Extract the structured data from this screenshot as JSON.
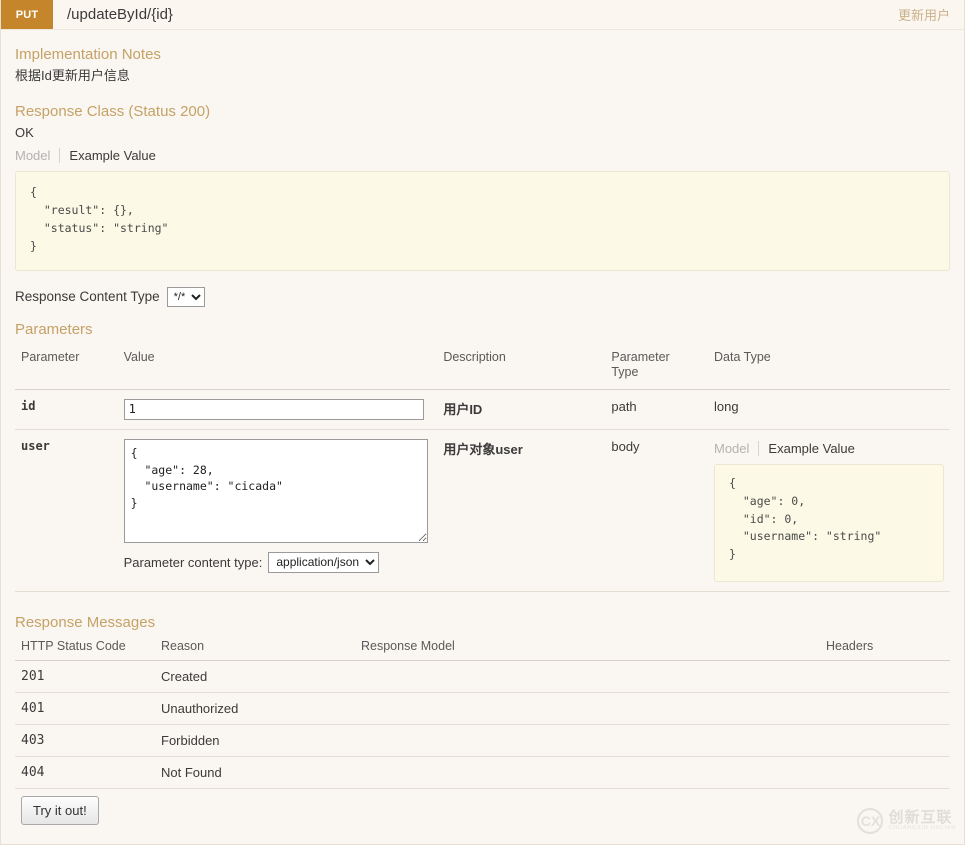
{
  "operation": {
    "method": "PUT",
    "path": "/updateById/{id}",
    "summary": "更新用户"
  },
  "implementation_notes": {
    "heading": "Implementation Notes",
    "text": "根据Id更新用户信息"
  },
  "response_class": {
    "heading": "Response Class (Status 200)",
    "status_text": "OK",
    "tabs": {
      "model": "Model",
      "example": "Example Value"
    },
    "example_value": "{\n  \"result\": {},\n  \"status\": \"string\"\n}"
  },
  "response_content_type": {
    "label": "Response Content Type",
    "selected": "*/*",
    "options": [
      "*/*"
    ]
  },
  "parameters": {
    "heading": "Parameters",
    "columns": {
      "parameter": "Parameter",
      "value": "Value",
      "description": "Description",
      "parameter_type_line1": "Parameter",
      "parameter_type_line2": "Type",
      "data_type": "Data Type"
    },
    "rows": [
      {
        "name": "id",
        "value": "1",
        "description": "用户ID",
        "param_type": "path",
        "data_type": "long"
      },
      {
        "name": "user",
        "value": "{\n  \"age\": 28,\n  \"username\": \"cicada\"\n}",
        "description": "用户对象user",
        "param_type": "body",
        "data_type_tabs": {
          "model": "Model",
          "example": "Example Value"
        },
        "data_type_example": "{\n  \"age\": 0,\n  \"id\": 0,\n  \"username\": \"string\"\n}",
        "content_type_label": "Parameter content type:",
        "content_type_selected": "application/json",
        "content_type_options": [
          "application/json"
        ]
      }
    ]
  },
  "response_messages": {
    "heading": "Response Messages",
    "columns": {
      "status_code": "HTTP Status Code",
      "reason": "Reason",
      "response_model": "Response Model",
      "headers": "Headers"
    },
    "rows": [
      {
        "code": "201",
        "reason": "Created",
        "model": "",
        "headers": ""
      },
      {
        "code": "401",
        "reason": "Unauthorized",
        "model": "",
        "headers": ""
      },
      {
        "code": "403",
        "reason": "Forbidden",
        "model": "",
        "headers": ""
      },
      {
        "code": "404",
        "reason": "Not Found",
        "model": "",
        "headers": ""
      }
    ]
  },
  "submit": {
    "label": "Try it out!"
  },
  "watermark": {
    "mark": "CX",
    "cn": "创新互联",
    "en": "CHUANGXIN HULIAN"
  },
  "colors": {
    "method_put": "#c5862b",
    "section_heading": "#c5a267",
    "summary": "#c9b189",
    "panel_bg": "#faf6f1",
    "snippet_bg": "#fcfae6"
  }
}
